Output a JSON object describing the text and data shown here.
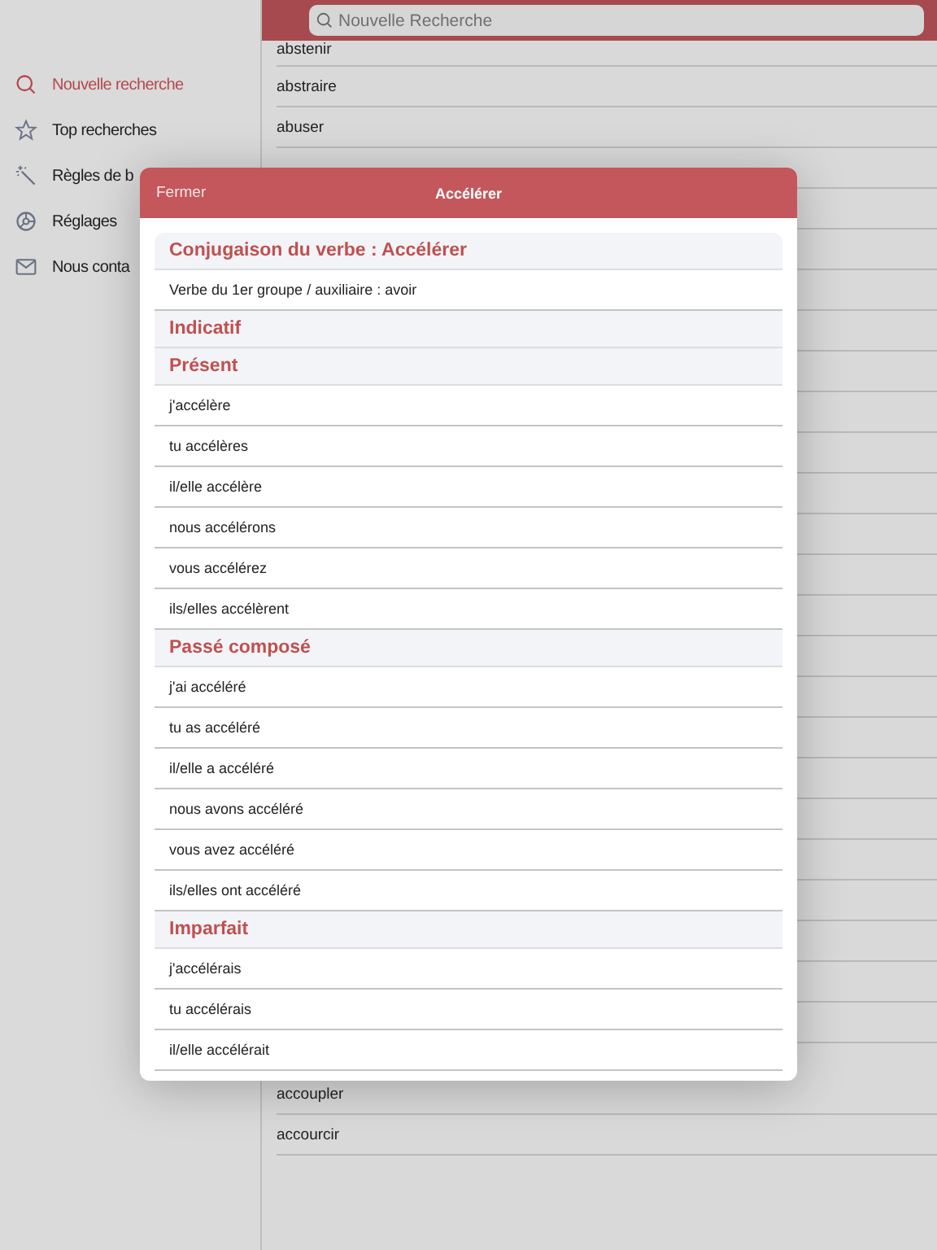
{
  "sidebar": {
    "items": [
      {
        "label": "Nouvelle recherche",
        "selected": true
      },
      {
        "label": "Top recherches",
        "selected": false
      },
      {
        "label": "Règles de b",
        "selected": false
      },
      {
        "label": "Réglages",
        "selected": false
      },
      {
        "label": "Nous conta",
        "selected": false
      }
    ]
  },
  "search": {
    "placeholder": "Nouvelle Recherche"
  },
  "list": {
    "top_rows": [
      "abstenir",
      "abstraire",
      "abuser"
    ],
    "bottom_rows": [
      "accoupler",
      "accourcir"
    ]
  },
  "modal": {
    "close": "Fermer",
    "title": "Accélérer",
    "entries": [
      {
        "kind": "heading",
        "text": "Conjugaison du verbe : Accélérer"
      },
      {
        "kind": "row",
        "text": "Verbe du 1er groupe / auxiliaire : avoir"
      },
      {
        "kind": "heading",
        "text": "Indicatif"
      },
      {
        "kind": "heading",
        "text": "Présent"
      },
      {
        "kind": "row",
        "text": "j'accélère"
      },
      {
        "kind": "row",
        "text": "tu accélères"
      },
      {
        "kind": "row",
        "text": "il/elle accélère"
      },
      {
        "kind": "row",
        "text": "nous accélérons"
      },
      {
        "kind": "row",
        "text": "vous accélérez"
      },
      {
        "kind": "row",
        "text": "ils/elles accélèrent"
      },
      {
        "kind": "heading",
        "text": "Passé composé"
      },
      {
        "kind": "row",
        "text": "j'ai accéléré"
      },
      {
        "kind": "row",
        "text": "tu as accéléré"
      },
      {
        "kind": "row",
        "text": "il/elle a accéléré"
      },
      {
        "kind": "row",
        "text": "nous avons accéléré"
      },
      {
        "kind": "row",
        "text": "vous avez accéléré"
      },
      {
        "kind": "row",
        "text": "ils/elles ont accéléré"
      },
      {
        "kind": "heading",
        "text": "Imparfait"
      },
      {
        "kind": "row",
        "text": "j'accélérais"
      },
      {
        "kind": "row",
        "text": "tu accélérais"
      },
      {
        "kind": "row",
        "text": "il/elle accélérait"
      }
    ]
  }
}
